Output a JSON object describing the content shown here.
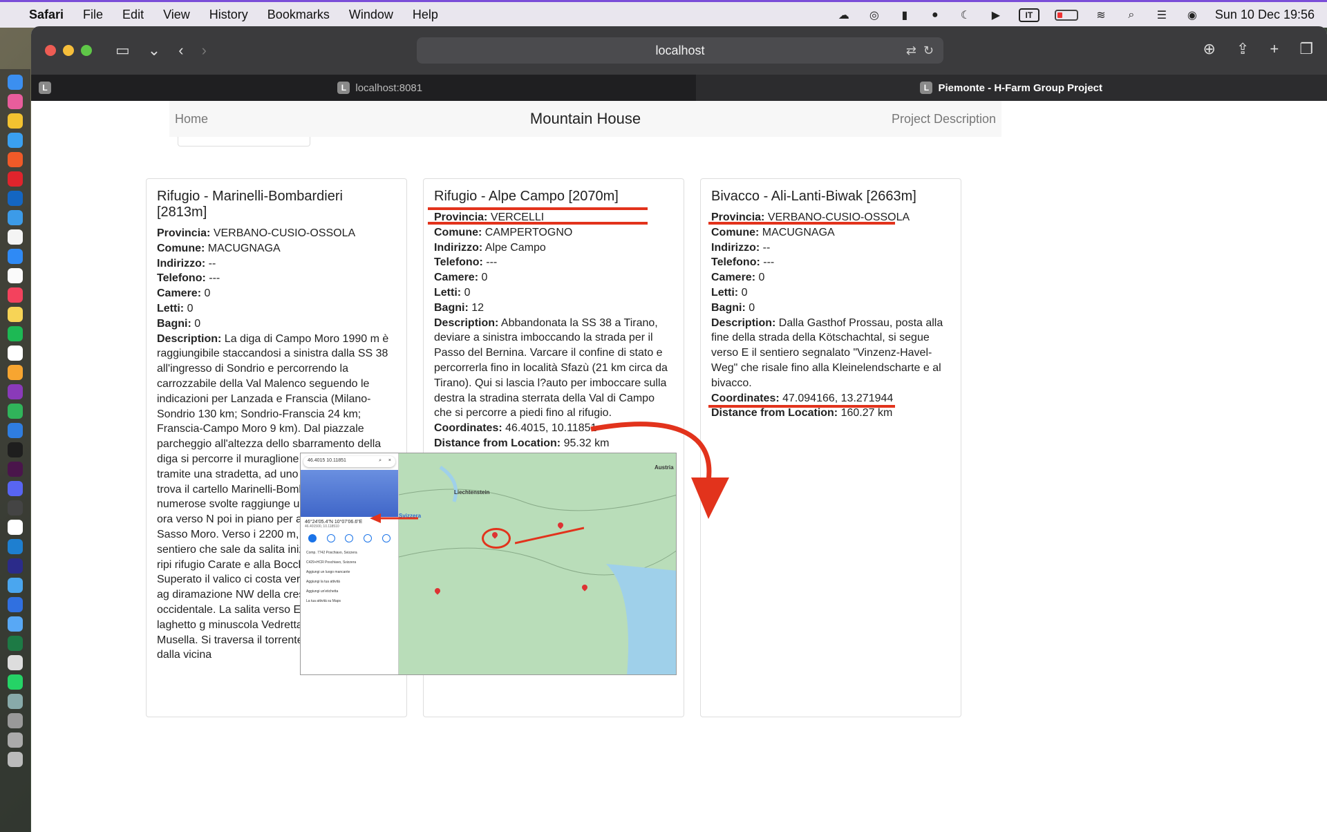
{
  "menubar": {
    "app": "Safari",
    "items": [
      "File",
      "Edit",
      "View",
      "History",
      "Bookmarks",
      "Window",
      "Help"
    ],
    "keyboard": "IT",
    "clock": "Sun 10 Dec  19:56"
  },
  "browser": {
    "address": "localhost",
    "tabs": [
      {
        "favicon": "L",
        "title": "localhost:8081"
      },
      {
        "favicon": "L",
        "title": "Piemonte - H-Farm Group Project"
      }
    ],
    "pinned_favicon": "L"
  },
  "navbar": {
    "home": "Home",
    "brand": "Mountain House",
    "project": "Project Description"
  },
  "labels": {
    "provincia": "Provincia:",
    "comune": "Comune:",
    "indirizzo": "Indirizzo:",
    "telefono": "Telefono:",
    "camere": "Camere:",
    "letti": "Letti:",
    "bagni": "Bagni:",
    "description": "Description:",
    "coordinates": "Coordinates:",
    "distance": "Distance from Location:"
  },
  "cards": [
    {
      "title": "Rifugio - Marinelli-Bombardieri [2813m]",
      "provincia": "VERBANO-CUSIO-OSSOLA",
      "comune": "MACUGNAGA",
      "indirizzo": "--",
      "telefono": "---",
      "camere": "0",
      "letti": "0",
      "bagni": "0",
      "description": "La diga di Campo Moro 1990 m è raggiungibile staccandosi a sinistra dalla SS 38 all'ingresso di Sondrio e percorrendo la carrozzabile della Val Malenco seguendo le indicazioni per Lanzada e Franscia (Milano-Sondrio 130 km; Sondrio-Franscia 24 km; Franscia-Campo Moro 9 km). Dal piazzale parcheggio all'altezza dello sbarramento della diga si percorre il muraglione per poi scendere, tramite una stradetta, ad uno s Traversatolo, si trova il cartello Marinelli-Bombardieri. Si segu numerose svolte raggiunge un boscoso. Si piega ora verso N poi in piano per aggirare le pro Sasso Moro. Verso i 2200 m, ( proviene il sentiero che sale da salita inizia a farsi di nuovo ripi rifugio Carate e alla Bocchetta m (ore 2). Superato il valico ci costa verso N su sfasciumi, ag diramazione NW della cresta V Musella occidentale. La salita verso E lambendo il laghetto g minuscola Vedretta delle Cime di Musella. Si traversa il torrente che si origina dalla vicina"
    },
    {
      "title": "Rifugio - Alpe Campo [2070m]",
      "provincia": "VERCELLI",
      "comune": "CAMPERTOGNO",
      "indirizzo": "Alpe Campo",
      "telefono": "---",
      "camere": "0",
      "letti": "0",
      "bagni": "12",
      "description": "Abbandonata la SS 38 a Tirano, deviare a sinistra imboccando la strada per il Passo del Bernina. Varcare il confine di stato e percorrerla fino in località Sfazù (21 km circa da Tirano). Qui si lascia l?auto per imboccare sulla destra la stradina sterrata della Val di Campo che si percorre a piedi fino al rifugio.",
      "coordinates": "46.4015, 10.11851",
      "distance": "95.32 km"
    },
    {
      "title": "Bivacco - Ali-Lanti-Biwak [2663m]",
      "provincia": "VERBANO-CUSIO-OSSOLA",
      "comune": "MACUGNAGA",
      "indirizzo": "--",
      "telefono": "---",
      "camere": "0",
      "letti": "0",
      "bagni": "0",
      "description": "Dalla Gasthof Prossau, posta alla fine della strada della Kötschachtal, si segue verso E il sentiero segnalato \"Vinzenz-Havel-Weg\" che risale fino alla Kleinelendscharte e al bivacco.",
      "coordinates": "47.094166, 13.271944",
      "distance": "160.27 km"
    }
  ],
  "map": {
    "search": "46.4015 10.11851",
    "coords_dms": "46°24'05.4\"N 10°07'06.6\"E",
    "coords_dec": "46.401500, 10.118510",
    "list": [
      "Comp. 7742 Poschiavo, Svizzera",
      "C429+HCR Poschiavo, Svizzera",
      "Aggiungi un luogo mancante",
      "Aggiungi la tua attività",
      "Aggiungi un'etichetta",
      "La tua attività su Maps"
    ],
    "labels": {
      "austria": "Austria",
      "liechtenstein": "Liechtenstein",
      "svizzera": "Svizzera"
    }
  },
  "colors": {
    "accent_red": "#e2331c",
    "menubar_border": "#7a4dd8"
  }
}
